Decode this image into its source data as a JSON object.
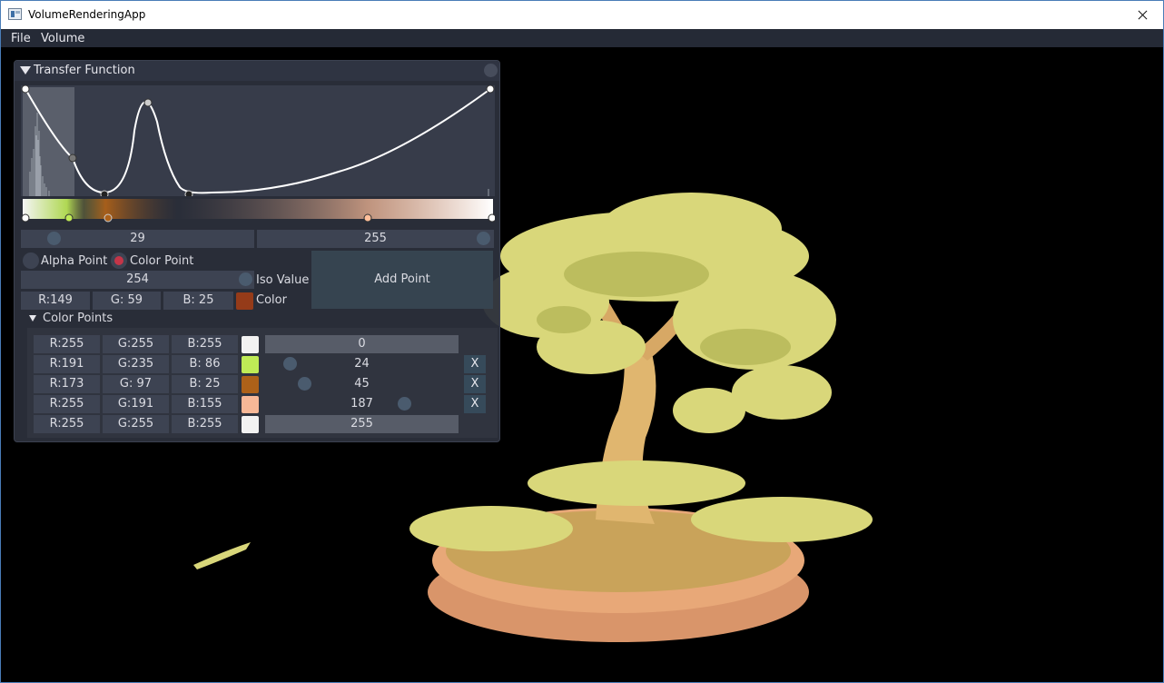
{
  "window": {
    "title": "VolumeRenderingApp"
  },
  "menu": {
    "items": [
      "File",
      "Volume"
    ]
  },
  "panel": {
    "title": "Transfer Function",
    "range_min": "29",
    "range_max": "255",
    "alpha_point_label": "Alpha Point",
    "color_point_label": "Color Point",
    "color_point_selected": true,
    "iso_value": "254",
    "iso_value_label": "Iso Value",
    "color_r": "R:149",
    "color_g": "G: 59",
    "color_b": "B: 25",
    "color_label": "Color",
    "color_swatch": "#953b19",
    "add_point_label": "Add Point",
    "color_points_title": "Color Points",
    "color_points": [
      {
        "r": "R:255",
        "g": "G:255",
        "b": "B:255",
        "swatch": "#ffffff",
        "pos": "0",
        "slider": 0.0,
        "removable": false
      },
      {
        "r": "R:191",
        "g": "G:235",
        "b": "B: 86",
        "swatch": "#bfeb56",
        "pos": "24",
        "slider": 0.094,
        "removable": true
      },
      {
        "r": "R:173",
        "g": "G: 97",
        "b": "B: 25",
        "swatch": "#ad6119",
        "pos": "45",
        "slider": 0.176,
        "removable": true
      },
      {
        "r": "R:255",
        "g": "G:191",
        "b": "B:155",
        "swatch": "#ffbf9b",
        "pos": "187",
        "slider": 0.733,
        "removable": true
      },
      {
        "r": "R:255",
        "g": "G:255",
        "b": "B:255",
        "swatch": "#ffffff",
        "pos": "255",
        "slider": 1.0,
        "removable": false
      }
    ],
    "remove_label": "X"
  },
  "colors": {
    "accent": "#c43548",
    "knob": "#4a5b6e",
    "panel_bg": "#2b2f3b",
    "field_bg": "#3d4352"
  }
}
